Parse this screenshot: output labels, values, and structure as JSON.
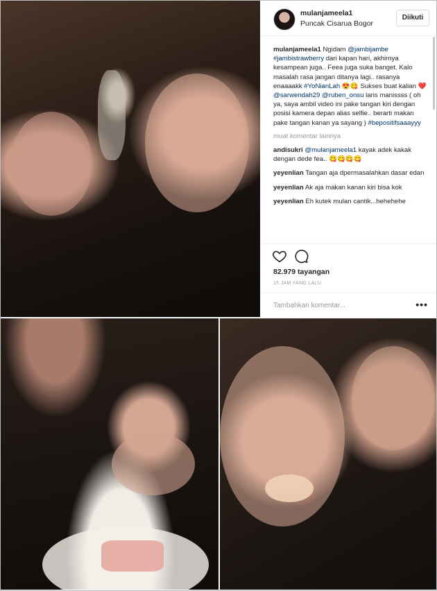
{
  "post": {
    "username": "mulanjameela1",
    "location": "Puncak Cisarua Bogor",
    "follow_label": "Diikuti",
    "caption": {
      "author": "mulanjameela1",
      "parts": [
        "Ngidam ",
        "@jambijambe",
        " ",
        "#jambistrawberry",
        " dari kapan hari, akhirnya kesampean juga.. Feea juga suka banget. Kalo masalah rasa jangan ditanya lagi.. rasanya enaaaakk ",
        "#YoNianLah",
        " 😍😋 Sukses buat kalian ❤️ ",
        "@sarwendah29",
        " ",
        "@ruben_onsu",
        " laris manissss ( oh ya, saya ambil video ini pake tangan kiri dengan posisi kamera depan alias selfie.. berarti makan pake tangan kanan ya sayang ) ",
        "#bepositifsaaayyy"
      ]
    },
    "more_comments": "muat komentar lainnya",
    "comments": [
      {
        "user": "andisukri",
        "mention": "@mulanjameela1",
        "text": " kayak adek kakak dengan dede fea.. 😋😋😋😋"
      },
      {
        "user": "yeyenlian",
        "mention": "",
        "text": "Tangan aja dpermasalahkan dasar edan"
      },
      {
        "user": "yeyenlian",
        "mention": "",
        "text": "Ak aja makan kanan kiri bisa kok"
      },
      {
        "user": "yeyenlian",
        "mention": "",
        "text": "Eh kutek mulan cantik...hehehehe"
      }
    ],
    "views": "82.979 tayangan",
    "time": "15 JAM YANG LALU",
    "add_comment_placeholder": "Tambahkan komentar...",
    "more_icon": "•••",
    "icons": {
      "like": "heart-icon",
      "comment": "comment-bubble-icon"
    }
  }
}
